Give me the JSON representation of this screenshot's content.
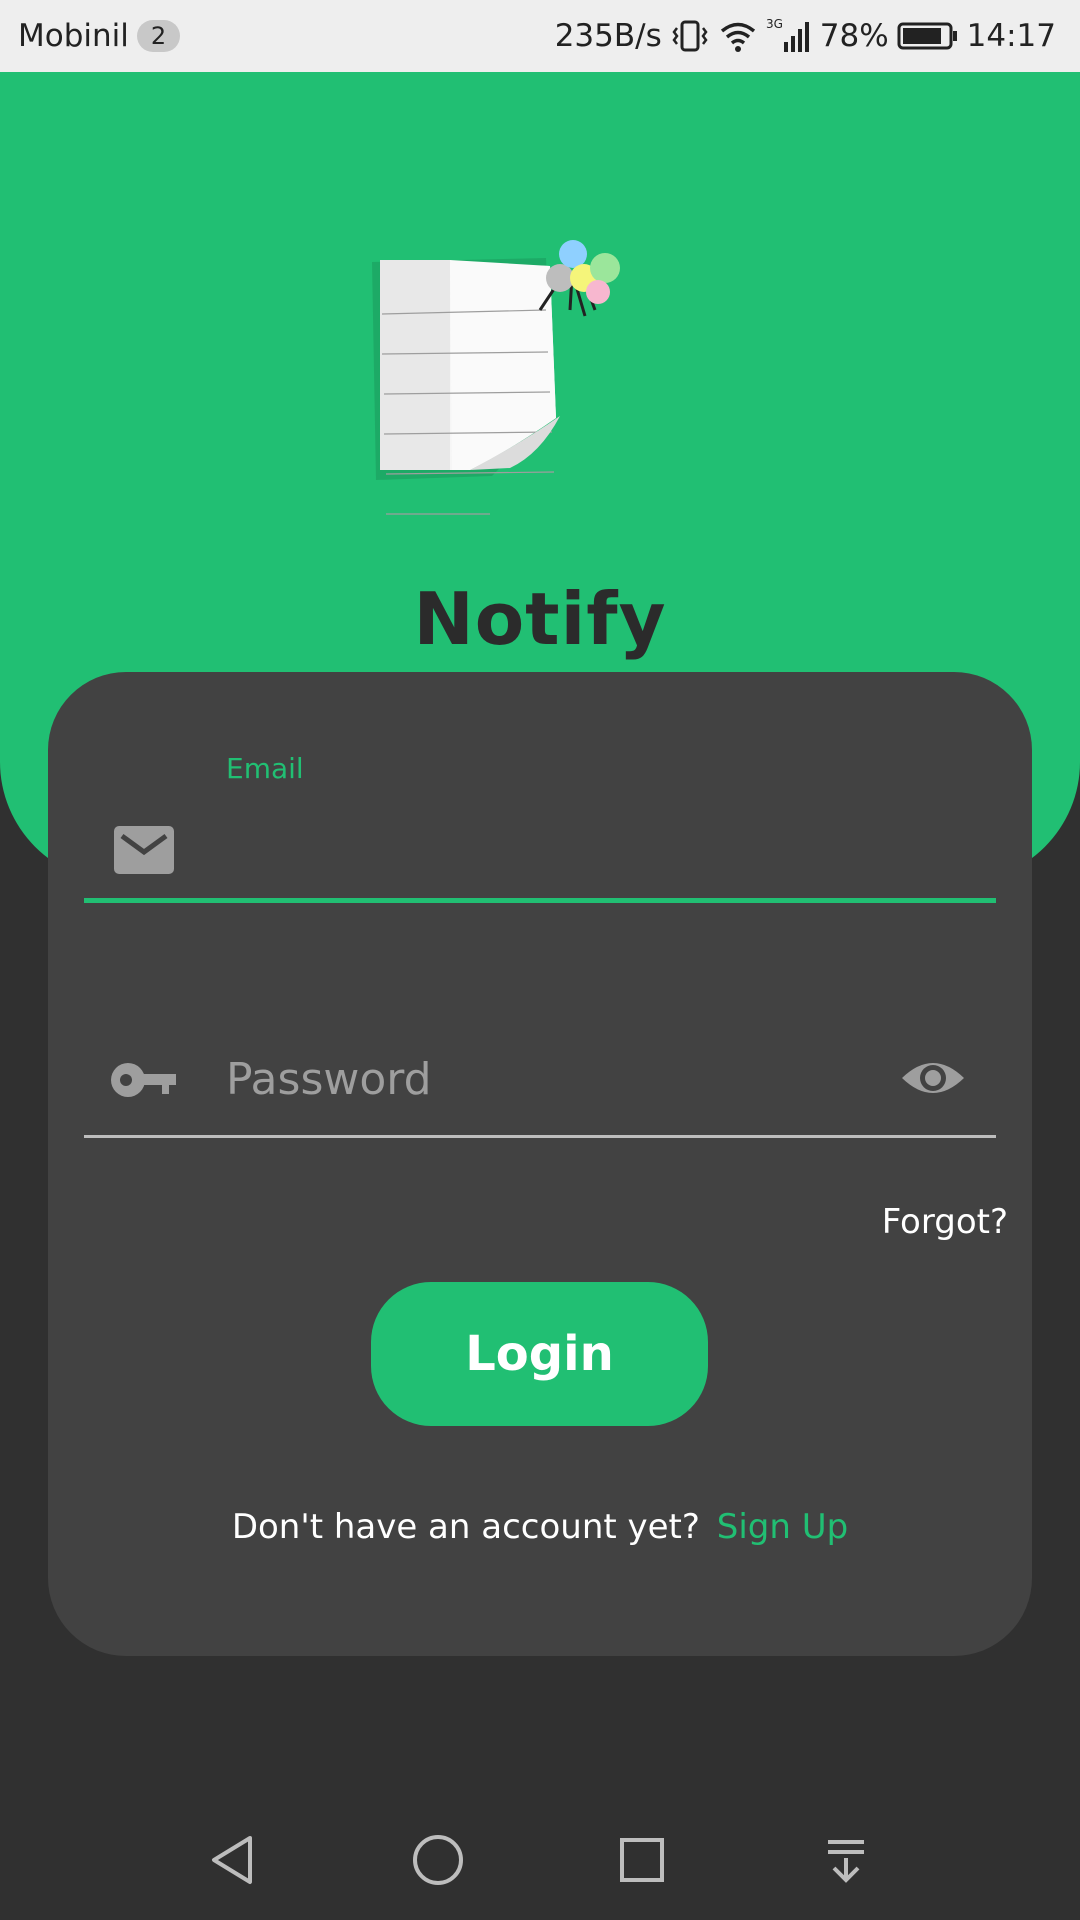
{
  "status_bar": {
    "carrier": "Mobinil",
    "sim_badge": "2",
    "net_speed": "235B/s",
    "network_type": "3G",
    "battery": "78%",
    "time": "14:17"
  },
  "app": {
    "title": "Notify"
  },
  "login_form": {
    "email_label": "Email",
    "email_value": "",
    "password_placeholder": "Password",
    "forgot_label": "Forgot?",
    "login_label": "Login",
    "signup_prompt": "Don't have an account yet?",
    "signup_link": "Sign Up"
  },
  "colors": {
    "accent": "#21bf73",
    "card": "#424242",
    "background": "#303030"
  },
  "icons": [
    "mail-icon",
    "key-icon",
    "eye-icon",
    "vibrate-icon",
    "wifi-icon",
    "signal-icon",
    "battery-icon",
    "back-icon",
    "home-icon",
    "recents-icon",
    "notification-pull-icon"
  ]
}
